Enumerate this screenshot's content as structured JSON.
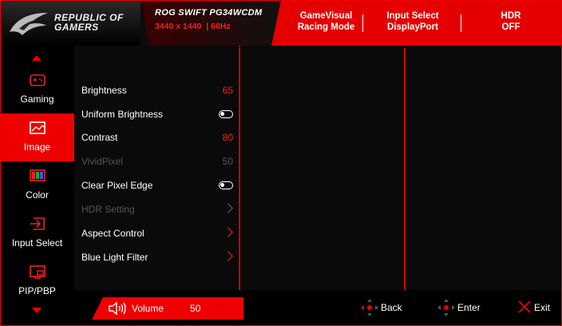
{
  "header": {
    "brand_line1": "REPUBLIC OF",
    "brand_line2": "GAMERS",
    "model": "ROG SWIFT PG34WCDM",
    "resolution": "3440 x 1440",
    "refresh": "60Hz",
    "status": [
      {
        "line1": "GameVisual",
        "line2": "Racing Mode"
      },
      {
        "line1": "Input Select",
        "line2": "DisplayPort"
      },
      {
        "line1": "HDR",
        "line2": "OFF"
      }
    ]
  },
  "sidebar": {
    "items": [
      {
        "label": "Gaming",
        "icon": "gamepad-icon"
      },
      {
        "label": "Image",
        "icon": "image-icon",
        "active": true
      },
      {
        "label": "Color",
        "icon": "color-icon"
      },
      {
        "label": "Input Select",
        "icon": "input-select-icon"
      },
      {
        "label": "PIP/PBP",
        "icon": "pip-pbp-icon"
      }
    ]
  },
  "menu": {
    "items": [
      {
        "label": "Brightness",
        "value": "65",
        "type": "value"
      },
      {
        "label": "Uniform Brightness",
        "type": "toggle"
      },
      {
        "label": "Contrast",
        "value": "80",
        "type": "value"
      },
      {
        "label": "VividPixel",
        "value": "50",
        "type": "value",
        "disabled": true
      },
      {
        "label": "Clear Pixel Edge",
        "type": "toggle"
      },
      {
        "label": "HDR Setting",
        "type": "submenu",
        "disabled": true
      },
      {
        "label": "Aspect Control",
        "type": "submenu"
      },
      {
        "label": "Blue Light Filter",
        "type": "submenu"
      }
    ]
  },
  "footer": {
    "volume_label": "Volume",
    "volume_value": "50",
    "back_label": "Back",
    "enter_label": "Enter",
    "exit_label": "Exit"
  },
  "colors": {
    "accent": "#e40000",
    "background": "#0a0a0a",
    "disabled_text": "#555555"
  }
}
